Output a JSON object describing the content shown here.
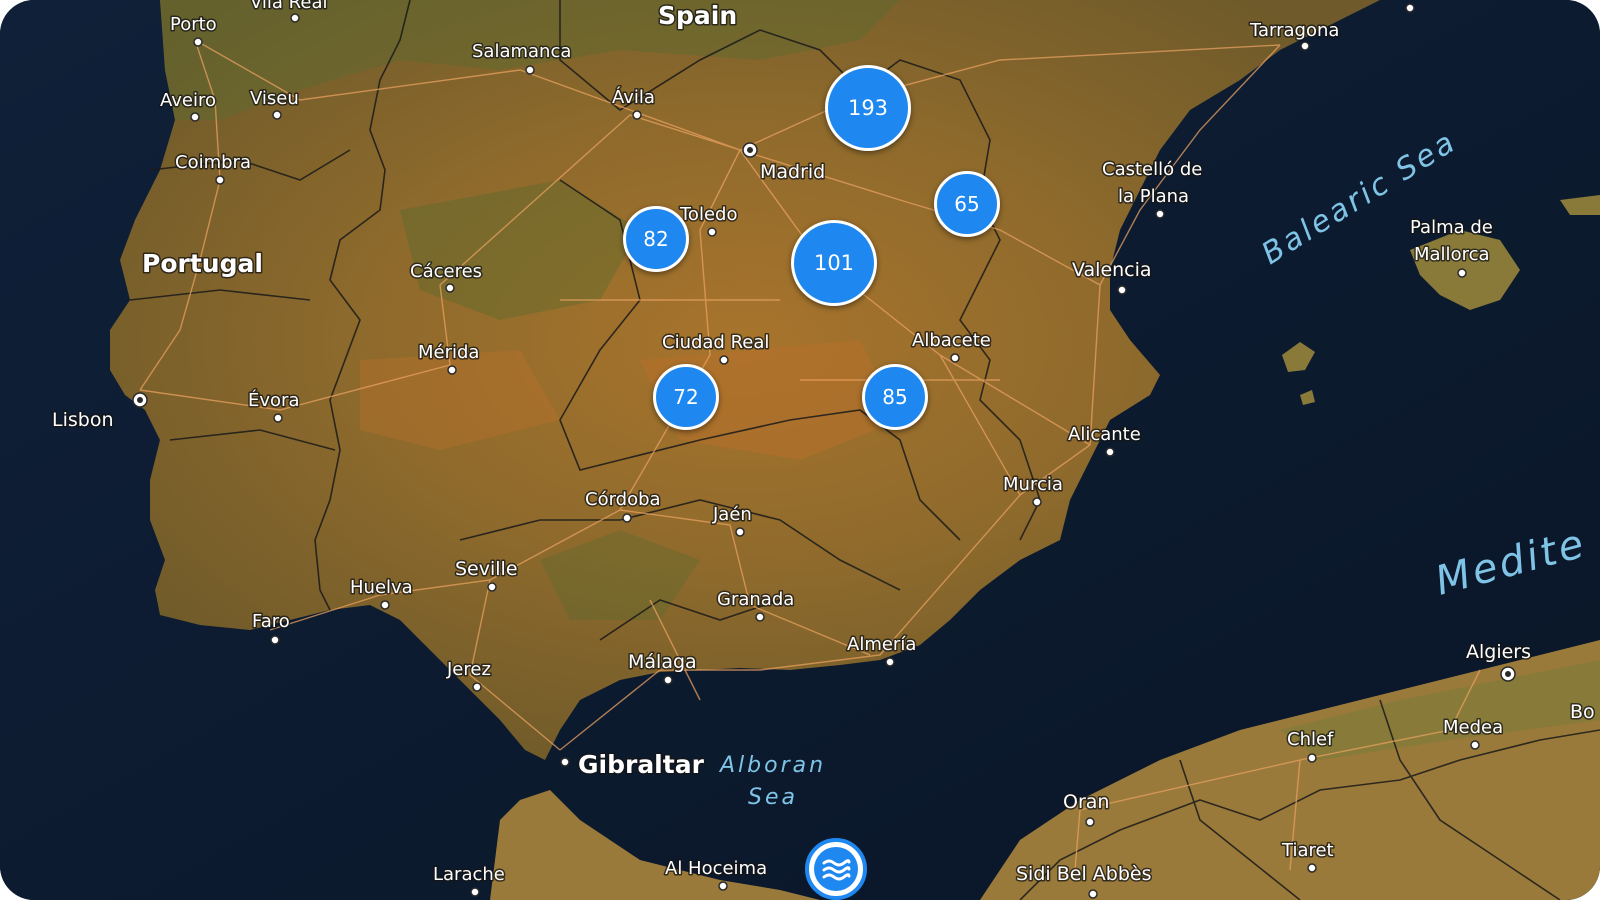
{
  "map": {
    "countries": [
      "Spain",
      "Portugal"
    ],
    "capitals": [
      "Madrid",
      "Lisbon",
      "Algiers"
    ],
    "cities": [
      "Porto",
      "Vila Real",
      "Aveiro",
      "Viseu",
      "Coimbra",
      "Salamanca",
      "Ávila",
      "Toledo",
      "Cáceres",
      "Mérida",
      "Évora",
      "Ciudad Real",
      "Albacete",
      "Valencia",
      "Castelló de",
      "la Plana",
      "Tarragona",
      "Palma de",
      "Mallorca",
      "Alicante",
      "Murcia",
      "Córdoba",
      "Jaén",
      "Seville",
      "Huelva",
      "Faro",
      "Granada",
      "Almería",
      "Málaga",
      "Jerez",
      "Gibraltar",
      "Larache",
      "Al Hoceima",
      "Oran",
      "Chlef",
      "Medea",
      "Tiaret",
      "Sidi Bel Abbès",
      "Bo"
    ],
    "seas": [
      "Balearic Sea",
      "Alboran",
      "Sea",
      "Medite"
    ]
  },
  "clusters": [
    {
      "count": "193"
    },
    {
      "count": "65"
    },
    {
      "count": "82"
    },
    {
      "count": "101"
    },
    {
      "count": "72"
    },
    {
      "count": "85"
    }
  ],
  "colors": {
    "land": "#8a6a30",
    "sea": "#0c1a30",
    "cluster": "#1e88f0",
    "roads": "#e8a060"
  },
  "layers_button": {
    "icon": "waves-icon"
  }
}
